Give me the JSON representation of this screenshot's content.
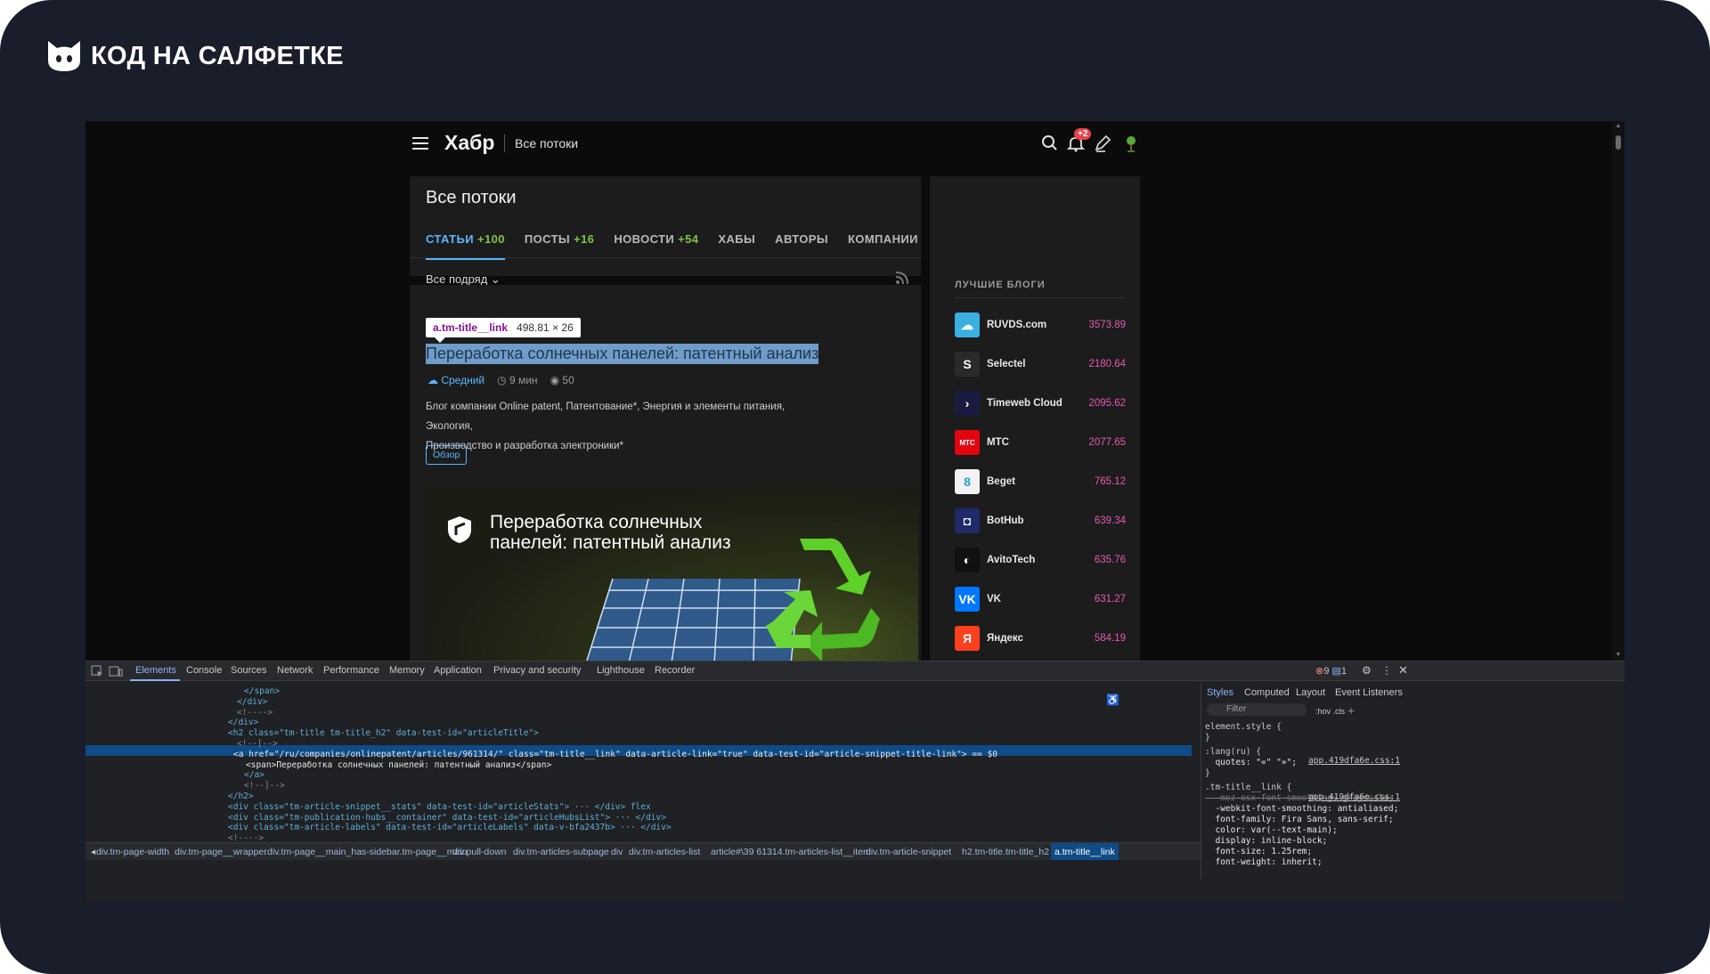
{
  "brand": {
    "name": "КОД НА САЛФЕТКЕ",
    "logo_icon": "cat-face-icon"
  },
  "habr": {
    "logo": "Хабр",
    "section": "Все потоки",
    "notifications_count": "+2",
    "icons": [
      "menu-icon",
      "search-icon",
      "bell-icon",
      "pen-icon",
      "avatar-icon"
    ]
  },
  "flows": {
    "title": "Все потоки",
    "tabs": [
      {
        "label": "СТАТЬИ",
        "count": "+100"
      },
      {
        "label": "ПОСТЫ",
        "count": "+16"
      },
      {
        "label": "НОВОСТИ",
        "count": "+54"
      },
      {
        "label": "ХАБЫ",
        "count": ""
      },
      {
        "label": "АВТОРЫ",
        "count": ""
      },
      {
        "label": "КОМПАНИИ",
        "count": ""
      }
    ],
    "filter": "Все подряд"
  },
  "article": {
    "inspect_selector": "a.tm-title__link",
    "inspect_size": "498.81 × 26",
    "title": "Переработка солнечных панелей: патентный анализ",
    "level": "Средний",
    "read_time": "9 мин",
    "views": "50",
    "hubs_line1": "Блог компании Online patent, Патентование*, Энергия и элементы питания, Экология,",
    "hubs_line2": "Производство и разработка электроники*",
    "label": "Обзор",
    "cover_line1": "Переработка солнечных",
    "cover_line2": "панелей: патентный анализ"
  },
  "blogs": {
    "title": "ЛУЧШИЕ БЛОГИ",
    "items": [
      {
        "name": "RUVDS.com",
        "score": "3573.89",
        "color": "#3ab0e0",
        "glyph": "☁"
      },
      {
        "name": "Selectel",
        "score": "2180.64",
        "color": "#2a2a2a",
        "glyph": "S"
      },
      {
        "name": "Timeweb Cloud",
        "score": "2095.62",
        "color": "#1a1a40",
        "glyph": "›"
      },
      {
        "name": "МТС",
        "score": "2077.65",
        "color": "#e30611",
        "glyph": "МТС"
      },
      {
        "name": "Beget",
        "score": "765.12",
        "color": "#f2f2f2",
        "glyph": "8"
      },
      {
        "name": "BotHub",
        "score": "639.34",
        "color": "#1e2a6a",
        "glyph": "◘"
      },
      {
        "name": "AvitoTech",
        "score": "635.76",
        "color": "#111111",
        "glyph": "◐"
      },
      {
        "name": "VK",
        "score": "631.27",
        "color": "#0077ff",
        "glyph": "VK"
      },
      {
        "name": "Яндекс",
        "score": "584.19",
        "color": "#fc3f1d",
        "glyph": "Я"
      }
    ]
  },
  "devtools": {
    "tabs": [
      "Elements",
      "Console",
      "Sources",
      "Network",
      "Performance",
      "Memory",
      "Application",
      "Privacy and security",
      "Lighthouse",
      "Recorder"
    ],
    "errors": "9",
    "messages": "1",
    "code_lines": [
      "</span>",
      "</div>",
      "<!---->",
      "</div>",
      "<h2 class=\"tm-title tm-title_h2\" data-test-id=\"articleTitle\">",
      "<!--[-->",
      "<a href=\"/ru/companies/onlinepatent/articles/961314/\" class=\"tm-title__link\" data-article-link=\"true\" data-test-id=\"article-snippet-title-link\"> == $0",
      "<span>Переработка солнечных панелей: патентный анализ</span>",
      "</a>",
      "<!--]-->",
      "</h2>",
      "<div class=\"tm-article-snippet__stats\" data-test-id=\"articleStats\"> ··· </div> flex",
      "<div class=\"tm-publication-hubs__container\" data-test-id=\"articleHubsList\"> ··· </div>",
      "<div class=\"tm-article-labels\" data-test-id=\"articleLabels\" data-v-bfa2437b> ··· </div>",
      "<!---->"
    ],
    "styles_tabs": [
      "Styles",
      "Computed",
      "Layout",
      "Event Listeners"
    ],
    "filter_placeholder": "Filter",
    "styles_lines": [
      "element.style {",
      "}",
      ":lang(ru) {",
      "  quotes: \"«\" \"»\";",
      "}",
      ".tm-title__link {",
      "  -moz-osx-font-smoothing: grayscale;",
      "  -webkit-font-smoothing: antialiased;",
      "  font-family: Fira Sans, sans-serif;",
      "  color: var(--text-main);",
      "  display: inline-block;",
      "  font-size: 1.25rem;",
      "  font-weight: inherit;"
    ],
    "styles_source": "app.419dfa6e.css:1",
    "breadcrumbs": [
      "div.tm-page-width",
      "div.tm-page__wrapper",
      "div.tm-page__main_has-sidebar.tm-page__main",
      "div.pull-down",
      "div.tm-articles-subpage",
      "div",
      "div.tm-articles-list",
      "article#\\39 61314.tm-articles-list__item",
      "div.tm-article-snippet",
      "h2.tm-title.tm-title_h2",
      "a.tm-title__link"
    ]
  }
}
